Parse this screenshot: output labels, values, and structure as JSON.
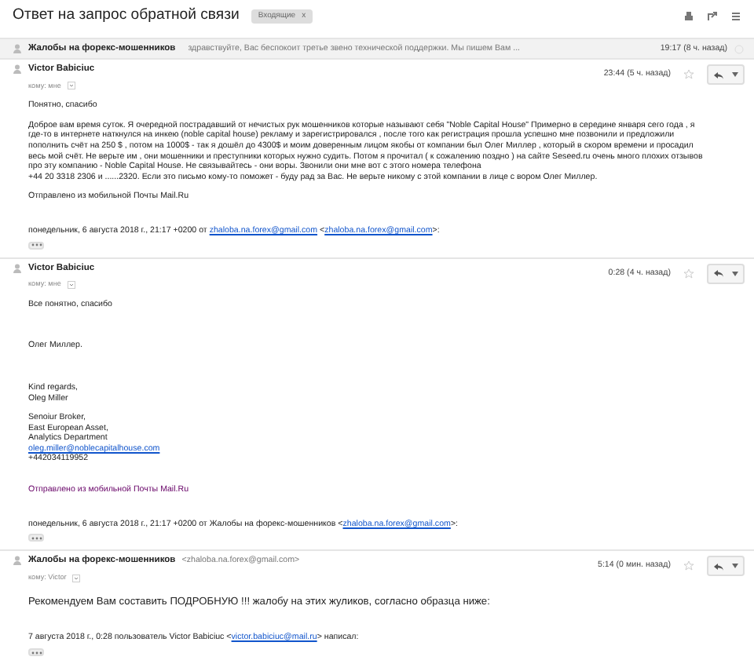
{
  "title": "Ответ на запрос обратной связи",
  "label": {
    "text": "Входящие",
    "close": "x"
  },
  "messages": [
    {
      "kind": "collapsed",
      "sender": "Жалобы на форекс-мошенников",
      "snippet": "здравствуйте, Вас беспокоит третье звено технической поддержки. Мы пишем Вам ...",
      "time": "19:17 (8 ч. назад)"
    },
    {
      "kind": "expanded",
      "sender": "Victor Babiciuc",
      "to": "кому: мне",
      "time": "23:44 (5 ч. назад)",
      "blocks": [
        {
          "kind": "text",
          "text": "Понятно, спасибо"
        },
        {
          "kind": "text",
          "text": "Доброе вам время суток. Я очередной пострадавший от нечистых рук мошенников которые называют себя \"Noble Capital House\" Примерно в середине января сего года , я где-то в интернете наткнулся на инкею (noble capital house) рекламу и зарегистрировался , после того как регистрация прошла успешно мне позвонили и предложили пополнить счёт на 250 $ , потом на 1000$ - так я дошёл до 4300$ и моим доверенным лицом якобы от компании был Олег Миллер , который в скором времени и просадил весь мой счёт. Не верьте им , они мошенники и преступники которых нужно судить. Потом я прочитал ( к сожалению поздно ) на сайте Seseed.ru очень много плохих отзывов про эту компанию - Noble Capital House. Не связывайтесь - они воры. Звонили они мне вот с этого номера телефона"
        },
        {
          "kind": "line",
          "text": "+44 20 3318 2306 и ......2320. Если это письмо кому-то поможет - буду рад за Вас. Не верьте никому с этой компании в лице с вором Олег Миллер."
        },
        {
          "kind": "text",
          "text": "Отправлено из мобильной Почты Mail.Ru"
        },
        {
          "kind": "attribution",
          "runs": [
            {
              "text": "понедельник, 6 августа 2018 г., 21:17 +0200 от ",
              "link": false
            },
            {
              "text": "zhaloba.na.forex@gmail.com",
              "link": true
            },
            {
              "text": " <",
              "link": false
            },
            {
              "text": "zhaloba.na.forex@gmail.com",
              "link": true
            },
            {
              "text": ">:",
              "link": false
            }
          ]
        },
        {
          "kind": "dots"
        }
      ]
    },
    {
      "kind": "expanded",
      "sender": "Victor Babiciuc",
      "to": "кому: мне",
      "time": "0:28 (4 ч. назад)",
      "blocks": [
        {
          "kind": "text",
          "text": "Все понятно, спасибо"
        },
        {
          "kind": "far",
          "text": "Олег Миллер."
        },
        {
          "kind": "far",
          "text": "Kind regards,"
        },
        {
          "kind": "line",
          "text": "Oleg Miller"
        },
        {
          "kind": "text",
          "text": "Senoiur Broker,"
        },
        {
          "kind": "line",
          "text": "East European Asset,"
        },
        {
          "kind": "line",
          "text": "Analytics Department"
        },
        {
          "kind": "link",
          "text": "oleg.miller@noblecapitalhouse.com"
        },
        {
          "kind": "line",
          "text": "+442034119952"
        },
        {
          "kind": "mobile",
          "text": "Отправлено из мобильной Почты Mail.Ru"
        },
        {
          "kind": "attribution",
          "runs": [
            {
              "text": "понедельник, 6 августа 2018 г., 21:17 +0200 от Жалобы на форекс-мошенников <",
              "link": false
            },
            {
              "text": "zhaloba.na.forex@gmail.com",
              "link": true
            },
            {
              "text": ">:",
              "link": false
            }
          ]
        },
        {
          "kind": "dots"
        }
      ]
    },
    {
      "kind": "expanded",
      "sender": "Жалобы на форекс-мошенников",
      "address": "<zhaloba.na.forex@gmail.com>",
      "to": "кому: Victor",
      "time": "5:14 (0 мин. назад)",
      "blocks": [
        {
          "kind": "big",
          "text": "Рекомендуем Вам составить ПОДРОБНУЮ !!! жалобу на этих жуликов, согласно образца ниже:"
        },
        {
          "kind": "attribution",
          "runs": [
            {
              "text": "7 августа 2018 г., 0:28 пользователь Victor Babiciuc <",
              "link": false
            },
            {
              "text": "victor.babiciuc@mail.ru",
              "link": true
            },
            {
              "text": "> написал:",
              "link": false
            }
          ]
        },
        {
          "kind": "dots"
        }
      ]
    }
  ]
}
